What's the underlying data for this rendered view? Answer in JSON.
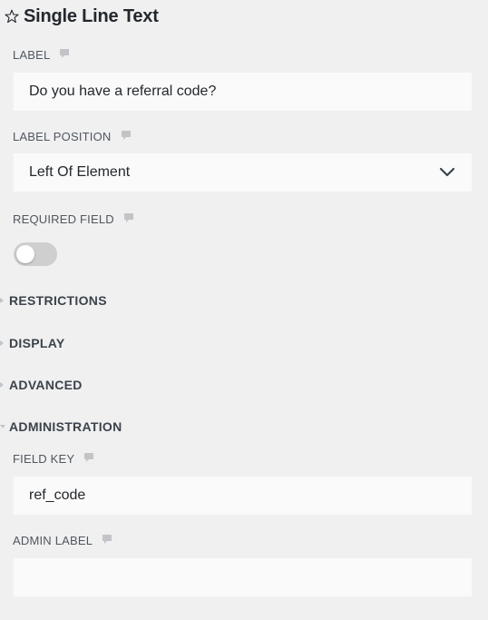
{
  "header": {
    "title": "Single Line Text",
    "icon": "star-icon"
  },
  "label_field": {
    "label": "LABEL",
    "value": "Do you have a referral code?"
  },
  "label_position": {
    "label": "LABEL POSITION",
    "value": "Left Of Element"
  },
  "required_field": {
    "label": "REQUIRED FIELD",
    "enabled": false
  },
  "sections": [
    {
      "label": "RESTRICTIONS",
      "expanded": false
    },
    {
      "label": "DISPLAY",
      "expanded": false
    },
    {
      "label": "ADVANCED",
      "expanded": false
    },
    {
      "label": "ADMINISTRATION",
      "expanded": true
    }
  ],
  "field_key": {
    "label": "FIELD KEY",
    "value": "ref_code"
  },
  "admin_label": {
    "label": "ADMIN LABEL",
    "value": ""
  },
  "colors": {
    "background": "#f0f0f1",
    "input_background": "#fafafa",
    "toggle_off": "#cfcfcf",
    "help_icon": "#c3c4c7"
  }
}
